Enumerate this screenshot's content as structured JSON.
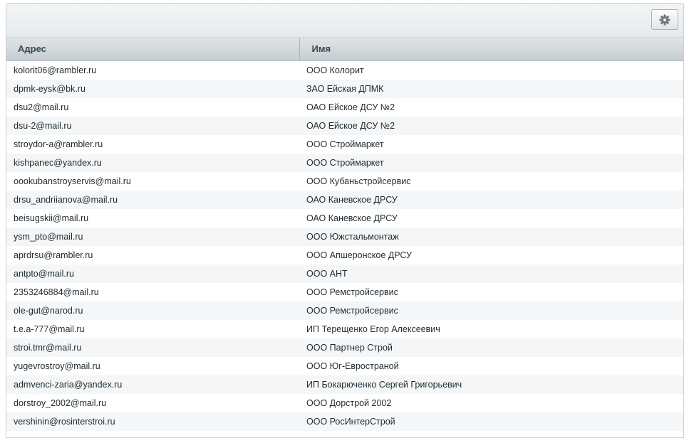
{
  "columns": {
    "address": "Адрес",
    "name": "Имя"
  },
  "toolbar": {
    "settings_icon": "gear-icon"
  },
  "rows": [
    {
      "address": "kolorit06@rambler.ru",
      "name": "ООО Колорит"
    },
    {
      "address": "dpmk-eysk@bk.ru",
      "name": "ЗАО Ейская ДПМК"
    },
    {
      "address": "dsu2@mail.ru",
      "name": "ОАО Ейское ДСУ №2"
    },
    {
      "address": "dsu-2@mail.ru",
      "name": "ОАО Ейское ДСУ №2"
    },
    {
      "address": "stroydor-a@rambler.ru",
      "name": "ООО Строймаркет"
    },
    {
      "address": "kishpanec@yandex.ru",
      "name": "ООО Строймаркет"
    },
    {
      "address": "oookubanstroyservis@mail.ru",
      "name": "ООО Кубаньстройсервис"
    },
    {
      "address": "drsu_andriianova@mail.ru",
      "name": "ОАО Каневское ДРСУ"
    },
    {
      "address": "beisugskii@mail.ru",
      "name": "ОАО Каневское ДРСУ"
    },
    {
      "address": "ysm_pto@mail.ru",
      "name": "ООО Южстальмонтаж"
    },
    {
      "address": "aprdrsu@rambler.ru",
      "name": "ООО Апшеронское ДРСУ"
    },
    {
      "address": "antpto@mail.ru",
      "name": "ООО АНТ"
    },
    {
      "address": "2353246884@mail.ru",
      "name": "ООО Ремстройсервис"
    },
    {
      "address": "ole-gut@narod.ru",
      "name": "ООО Ремстройсервис"
    },
    {
      "address": "t.e.a-777@mail.ru",
      "name": "ИП Терещенко Егор Алексеевич"
    },
    {
      "address": "stroi.tmr@mail.ru",
      "name": "ООО Партнер Строй"
    },
    {
      "address": "yugevrostroy@mail.ru",
      "name": "ООО Юг-Евространой"
    },
    {
      "address": "admvenci-zaria@yandex.ru",
      "name": "ИП Бокарюченко Сергей Григорьевич"
    },
    {
      "address": "dorstroy_2002@mail.ru",
      "name": "ООО Дорстрой 2002"
    },
    {
      "address": "vershinin@rosinterstroi.ru",
      "name": "ООО РосИнтерСтрой"
    }
  ]
}
